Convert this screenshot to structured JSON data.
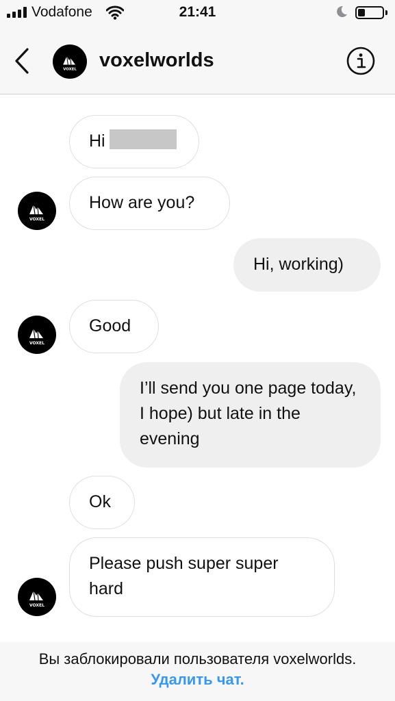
{
  "status_bar": {
    "carrier": "Vodafone",
    "time": "21:41",
    "battery_level": 0.3
  },
  "header": {
    "username": "voxelworlds",
    "avatar_label": "VOXEL"
  },
  "messages": [
    {
      "side": "incoming",
      "text": "Hi",
      "has_redaction": true
    },
    {
      "side": "incoming",
      "text": "How are you?"
    },
    {
      "side": "outgoing",
      "text": "Hi, working)"
    },
    {
      "side": "incoming",
      "text": "Good"
    },
    {
      "side": "outgoing",
      "text": "I’ll send you one page today, I hope) but late in the evening"
    },
    {
      "side": "incoming",
      "text": "Ok"
    },
    {
      "side": "incoming",
      "text": "Please push super super hard"
    }
  ],
  "footer": {
    "blocked_text": "Вы заблокировали пользователя voxelworlds.",
    "delete_chat": "Удалить чат."
  },
  "colors": {
    "link": "#3897f0",
    "outgoing_bubble": "#efefef",
    "bar_background": "#f7f7f7"
  }
}
